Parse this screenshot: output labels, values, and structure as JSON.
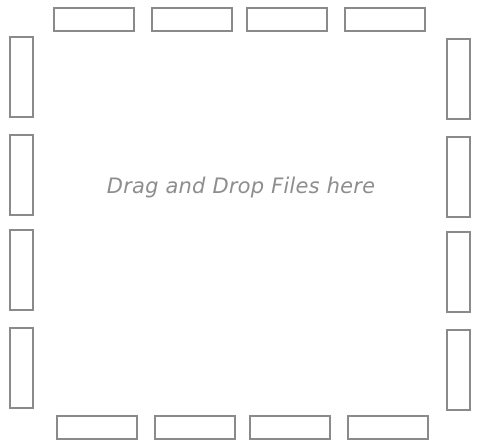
{
  "drop_zone": {
    "prompt": "Drag and Drop Files here",
    "border_color": "#8a8a8a",
    "text_color": "#8e8e8e"
  }
}
